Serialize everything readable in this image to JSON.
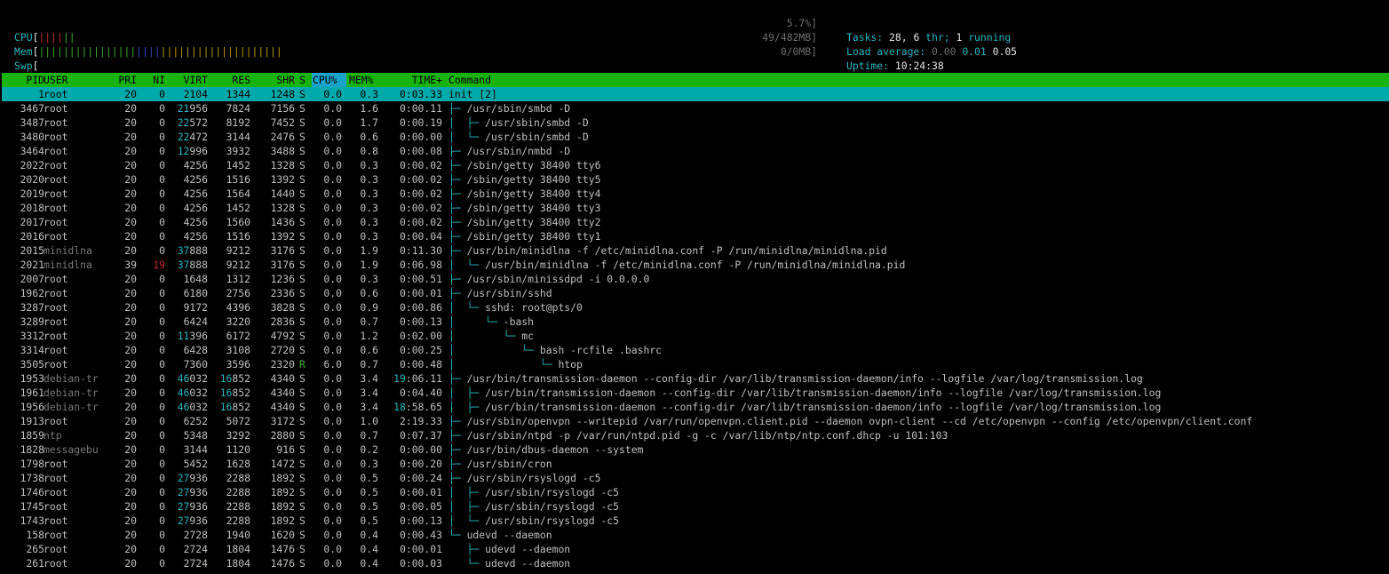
{
  "meters": {
    "cpu": {
      "label": "CPU",
      "open": "[",
      "bar_red": "||||",
      "bar_green": "||",
      "value": "5.7%]"
    },
    "mem": {
      "label": "Mem",
      "open": "[",
      "bar_green": "||||||||||||||||",
      "bar_blue": "||||",
      "bar_yellow": "||||||||||||||||||||",
      "value": "49/482MB]"
    },
    "swp": {
      "label": "Swp",
      "open": "[",
      "value": "0/0MB]"
    }
  },
  "summary": {
    "tasks_label": "Tasks:",
    "tasks_value": "28,",
    "thr_value": "6",
    "thr_label": "thr;",
    "running_value": "1",
    "running_label": "running",
    "load_label": "Load average:",
    "load1": "0.00",
    "load5": "0.01",
    "load15": "0.05",
    "uptime_label": "Uptime:",
    "uptime_value": "10:24:38"
  },
  "columns": [
    "PID",
    "USER",
    "PRI",
    "NI",
    "VIRT",
    "RES",
    "SHR",
    "S",
    "CPU%",
    "MEM%",
    "TIME+",
    "Command"
  ],
  "processes": [
    {
      "pid": "1",
      "user": "root",
      "pri": "20",
      "ni": "0",
      "virt": "2104",
      "res": "1344",
      "shr": "1248",
      "s": "S",
      "cpu": "0.0",
      "mem": "0.3",
      "time": "0:03.33",
      "tree": "",
      "cmd": "init [2]"
    },
    {
      "pid": "3467",
      "user": "root",
      "pri": "20",
      "ni": "0",
      "virt": "21956",
      "res": "7824",
      "shr": "7156",
      "s": "S",
      "cpu": "0.0",
      "mem": "1.6",
      "time": "0:00.11",
      "tree": "├─ ",
      "cmd": "/usr/sbin/smbd -D"
    },
    {
      "pid": "3487",
      "user": "root",
      "pri": "20",
      "ni": "0",
      "virt": "22572",
      "res": "8192",
      "shr": "7452",
      "s": "S",
      "cpu": "0.0",
      "mem": "1.7",
      "time": "0:00.19",
      "tree": "│  ├─ ",
      "cmd": "/usr/sbin/smbd -D"
    },
    {
      "pid": "3480",
      "user": "root",
      "pri": "20",
      "ni": "0",
      "virt": "22472",
      "res": "3144",
      "shr": "2476",
      "s": "S",
      "cpu": "0.0",
      "mem": "0.6",
      "time": "0:00.00",
      "tree": "│  └─ ",
      "cmd": "/usr/sbin/smbd -D"
    },
    {
      "pid": "3464",
      "user": "root",
      "pri": "20",
      "ni": "0",
      "virt": "12996",
      "res": "3932",
      "shr": "3488",
      "s": "S",
      "cpu": "0.0",
      "mem": "0.8",
      "time": "0:00.08",
      "tree": "├─ ",
      "cmd": "/usr/sbin/nmbd -D"
    },
    {
      "pid": "2022",
      "user": "root",
      "pri": "20",
      "ni": "0",
      "virt": "4256",
      "res": "1452",
      "shr": "1328",
      "s": "S",
      "cpu": "0.0",
      "mem": "0.3",
      "time": "0:00.02",
      "tree": "├─ ",
      "cmd": "/sbin/getty 38400 tty6"
    },
    {
      "pid": "2020",
      "user": "root",
      "pri": "20",
      "ni": "0",
      "virt": "4256",
      "res": "1516",
      "shr": "1392",
      "s": "S",
      "cpu": "0.0",
      "mem": "0.3",
      "time": "0:00.02",
      "tree": "├─ ",
      "cmd": "/sbin/getty 38400 tty5"
    },
    {
      "pid": "2019",
      "user": "root",
      "pri": "20",
      "ni": "0",
      "virt": "4256",
      "res": "1564",
      "shr": "1440",
      "s": "S",
      "cpu": "0.0",
      "mem": "0.3",
      "time": "0:00.02",
      "tree": "├─ ",
      "cmd": "/sbin/getty 38400 tty4"
    },
    {
      "pid": "2018",
      "user": "root",
      "pri": "20",
      "ni": "0",
      "virt": "4256",
      "res": "1452",
      "shr": "1328",
      "s": "S",
      "cpu": "0.0",
      "mem": "0.3",
      "time": "0:00.02",
      "tree": "├─ ",
      "cmd": "/sbin/getty 38400 tty3"
    },
    {
      "pid": "2017",
      "user": "root",
      "pri": "20",
      "ni": "0",
      "virt": "4256",
      "res": "1560",
      "shr": "1436",
      "s": "S",
      "cpu": "0.0",
      "mem": "0.3",
      "time": "0:00.02",
      "tree": "├─ ",
      "cmd": "/sbin/getty 38400 tty2"
    },
    {
      "pid": "2016",
      "user": "root",
      "pri": "20",
      "ni": "0",
      "virt": "4256",
      "res": "1516",
      "shr": "1392",
      "s": "S",
      "cpu": "0.0",
      "mem": "0.3",
      "time": "0:00.04",
      "tree": "├─ ",
      "cmd": "/sbin/getty 38400 tty1"
    },
    {
      "pid": "2015",
      "user": "minidlna",
      "pri": "20",
      "ni": "0",
      "virt": "37888",
      "res": "9212",
      "shr": "3176",
      "s": "S",
      "cpu": "0.0",
      "mem": "1.9",
      "time": "0:11.30",
      "tree": "├─ ",
      "cmd": "/usr/bin/minidlna -f /etc/minidlna.conf -P /run/minidlna/minidlna.pid"
    },
    {
      "pid": "2021",
      "user": "minidlna",
      "pri": "39",
      "ni": "19",
      "virt": "37888",
      "res": "9212",
      "shr": "3176",
      "s": "S",
      "cpu": "0.0",
      "mem": "1.9",
      "time": "0:06.98",
      "tree": "│  └─ ",
      "cmd": "/usr/bin/minidlna -f /etc/minidlna.conf -P /run/minidlna/minidlna.pid"
    },
    {
      "pid": "2007",
      "user": "root",
      "pri": "20",
      "ni": "0",
      "virt": "1648",
      "res": "1312",
      "shr": "1236",
      "s": "S",
      "cpu": "0.0",
      "mem": "0.3",
      "time": "0:00.51",
      "tree": "├─ ",
      "cmd": "/usr/sbin/minissdpd -i 0.0.0.0"
    },
    {
      "pid": "1962",
      "user": "root",
      "pri": "20",
      "ni": "0",
      "virt": "6180",
      "res": "2756",
      "shr": "2336",
      "s": "S",
      "cpu": "0.0",
      "mem": "0.6",
      "time": "0:00.01",
      "tree": "├─ ",
      "cmd": "/usr/sbin/sshd"
    },
    {
      "pid": "3287",
      "user": "root",
      "pri": "20",
      "ni": "0",
      "virt": "9172",
      "res": "4396",
      "shr": "3828",
      "s": "S",
      "cpu": "0.0",
      "mem": "0.9",
      "time": "0:00.86",
      "tree": "│  └─ ",
      "cmd": "sshd: root@pts/0"
    },
    {
      "pid": "3289",
      "user": "root",
      "pri": "20",
      "ni": "0",
      "virt": "6424",
      "res": "3220",
      "shr": "2836",
      "s": "S",
      "cpu": "0.0",
      "mem": "0.7",
      "time": "0:00.13",
      "tree": "│     └─ ",
      "cmd": "-bash"
    },
    {
      "pid": "3312",
      "user": "root",
      "pri": "20",
      "ni": "0",
      "virt": "11396",
      "res": "6172",
      "shr": "4792",
      "s": "S",
      "cpu": "0.0",
      "mem": "1.2",
      "time": "0:02.00",
      "tree": "│        └─ ",
      "cmd": "mc"
    },
    {
      "pid": "3314",
      "user": "root",
      "pri": "20",
      "ni": "0",
      "virt": "6428",
      "res": "3108",
      "shr": "2720",
      "s": "S",
      "cpu": "0.0",
      "mem": "0.6",
      "time": "0:00.25",
      "tree": "│           └─ ",
      "cmd": "bash -rcfile .bashrc"
    },
    {
      "pid": "3505",
      "user": "root",
      "pri": "20",
      "ni": "0",
      "virt": "7360",
      "res": "3596",
      "shr": "2320",
      "s": "R",
      "cpu": "6.0",
      "mem": "0.7",
      "time": "0:00.48",
      "tree": "│              └─ ",
      "cmd": "htop"
    },
    {
      "pid": "1953",
      "user": "debian-tr",
      "pri": "20",
      "ni": "0",
      "virt": "46032",
      "res": "16852",
      "shr": "4340",
      "s": "S",
      "cpu": "0.0",
      "mem": "3.4",
      "time": "19:06.11",
      "tree": "├─ ",
      "cmd": "/usr/bin/transmission-daemon --config-dir /var/lib/transmission-daemon/info --logfile /var/log/transmission.log"
    },
    {
      "pid": "1961",
      "user": "debian-tr",
      "pri": "20",
      "ni": "0",
      "virt": "46032",
      "res": "16852",
      "shr": "4340",
      "s": "S",
      "cpu": "0.0",
      "mem": "3.4",
      "time": "0:04.40",
      "tree": "│  ├─ ",
      "cmd": "/usr/bin/transmission-daemon --config-dir /var/lib/transmission-daemon/info --logfile /var/log/transmission.log"
    },
    {
      "pid": "1956",
      "user": "debian-tr",
      "pri": "20",
      "ni": "0",
      "virt": "46032",
      "res": "16852",
      "shr": "4340",
      "s": "S",
      "cpu": "0.0",
      "mem": "3.4",
      "time": "18:58.65",
      "tree": "│  ├─ ",
      "cmd": "/usr/bin/transmission-daemon --config-dir /var/lib/transmission-daemon/info --logfile /var/log/transmission.log"
    },
    {
      "pid": "1913",
      "user": "root",
      "pri": "20",
      "ni": "0",
      "virt": "6252",
      "res": "5072",
      "shr": "3172",
      "s": "S",
      "cpu": "0.0",
      "mem": "1.0",
      "time": "2:19.33",
      "tree": "├─ ",
      "cmd": "/usr/sbin/openvpn --writepid /var/run/openvpn.client.pid --daemon ovpn-client --cd /etc/openvpn --config /etc/openvpn/client.conf"
    },
    {
      "pid": "1859",
      "user": "ntp",
      "pri": "20",
      "ni": "0",
      "virt": "5348",
      "res": "3292",
      "shr": "2880",
      "s": "S",
      "cpu": "0.0",
      "mem": "0.7",
      "time": "0:07.37",
      "tree": "├─ ",
      "cmd": "/usr/sbin/ntpd -p /var/run/ntpd.pid -g -c /var/lib/ntp/ntp.conf.dhcp -u 101:103"
    },
    {
      "pid": "1828",
      "user": "messagebu",
      "pri": "20",
      "ni": "0",
      "virt": "3144",
      "res": "1120",
      "shr": "916",
      "s": "S",
      "cpu": "0.0",
      "mem": "0.2",
      "time": "0:00.00",
      "tree": "├─ ",
      "cmd": "/usr/bin/dbus-daemon --system"
    },
    {
      "pid": "1798",
      "user": "root",
      "pri": "20",
      "ni": "0",
      "virt": "5452",
      "res": "1628",
      "shr": "1472",
      "s": "S",
      "cpu": "0.0",
      "mem": "0.3",
      "time": "0:00.20",
      "tree": "├─ ",
      "cmd": "/usr/sbin/cron"
    },
    {
      "pid": "1738",
      "user": "root",
      "pri": "20",
      "ni": "0",
      "virt": "27936",
      "res": "2288",
      "shr": "1892",
      "s": "S",
      "cpu": "0.0",
      "mem": "0.5",
      "time": "0:00.24",
      "tree": "├─ ",
      "cmd": "/usr/sbin/rsyslogd -c5"
    },
    {
      "pid": "1746",
      "user": "root",
      "pri": "20",
      "ni": "0",
      "virt": "27936",
      "res": "2288",
      "shr": "1892",
      "s": "S",
      "cpu": "0.0",
      "mem": "0.5",
      "time": "0:00.01",
      "tree": "│  ├─ ",
      "cmd": "/usr/sbin/rsyslogd -c5"
    },
    {
      "pid": "1745",
      "user": "root",
      "pri": "20",
      "ni": "0",
      "virt": "27936",
      "res": "2288",
      "shr": "1892",
      "s": "S",
      "cpu": "0.0",
      "mem": "0.5",
      "time": "0:00.05",
      "tree": "│  ├─ ",
      "cmd": "/usr/sbin/rsyslogd -c5"
    },
    {
      "pid": "1743",
      "user": "root",
      "pri": "20",
      "ni": "0",
      "virt": "27936",
      "res": "2288",
      "shr": "1892",
      "s": "S",
      "cpu": "0.0",
      "mem": "0.5",
      "time": "0:00.13",
      "tree": "│  └─ ",
      "cmd": "/usr/sbin/rsyslogd -c5"
    },
    {
      "pid": "158",
      "user": "root",
      "pri": "20",
      "ni": "0",
      "virt": "2728",
      "res": "1940",
      "shr": "1620",
      "s": "S",
      "cpu": "0.0",
      "mem": "0.4",
      "time": "0:00.43",
      "tree": "└─ ",
      "cmd": "udevd --daemon"
    },
    {
      "pid": "265",
      "user": "root",
      "pri": "20",
      "ni": "0",
      "virt": "2724",
      "res": "1804",
      "shr": "1476",
      "s": "S",
      "cpu": "0.0",
      "mem": "0.4",
      "time": "0:00.01",
      "tree": "   ├─ ",
      "cmd": "udevd --daemon"
    },
    {
      "pid": "261",
      "user": "root",
      "pri": "20",
      "ni": "0",
      "virt": "2724",
      "res": "1804",
      "shr": "1476",
      "s": "S",
      "cpu": "0.0",
      "mem": "0.4",
      "time": "0:00.03",
      "tree": "   └─ ",
      "cmd": "udevd --daemon"
    }
  ],
  "colors": {
    "header_bg": "#19b30d",
    "selected_bg": "#00aaaa",
    "cyan": "#26b5c0",
    "red": "#c4282a",
    "green": "#3cae2e",
    "blue": "#3b46c9",
    "yellow": "#b79a0e"
  }
}
